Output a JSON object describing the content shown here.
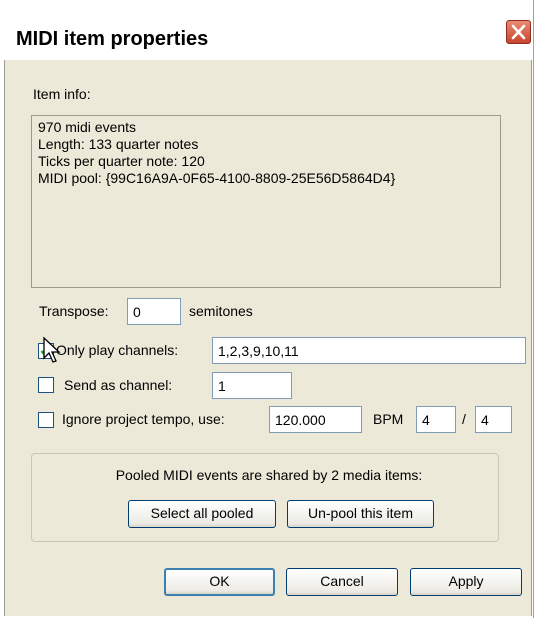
{
  "window": {
    "title": "MIDI item properties",
    "close_icon": "close-icon"
  },
  "item_info": {
    "label": "Item info:",
    "lines": [
      "970 midi events",
      "Length: 133 quarter notes",
      "Ticks per quarter note: 120",
      "MIDI pool: {99C16A9A-0F65-4100-8809-25E56D5864D4}"
    ]
  },
  "transpose": {
    "label": "Transpose:",
    "value": "0",
    "unit": "semitones"
  },
  "only_play_channels": {
    "label": "Only play channels:",
    "checked": true,
    "value": "1,2,3,9,10,11"
  },
  "send_as_channel": {
    "label": "Send as channel:",
    "checked": false,
    "value": "1"
  },
  "ignore_tempo": {
    "label": "Ignore project tempo, use:",
    "checked": false,
    "bpm_value": "120.000",
    "bpm_label": "BPM",
    "time_sig_num": "4",
    "separator": "/",
    "time_sig_den": "4"
  },
  "pool": {
    "message": "Pooled MIDI events are shared by 2 media items:",
    "select_all_label": "Select all pooled",
    "unpool_label": "Un-pool this item"
  },
  "buttons": {
    "ok_label": "OK",
    "cancel_label": "Cancel",
    "apply_label": "Apply"
  },
  "colors": {
    "dialog_bg": "#ece9d8",
    "close_button": "#c8442b",
    "check_mark": "#21a121"
  }
}
